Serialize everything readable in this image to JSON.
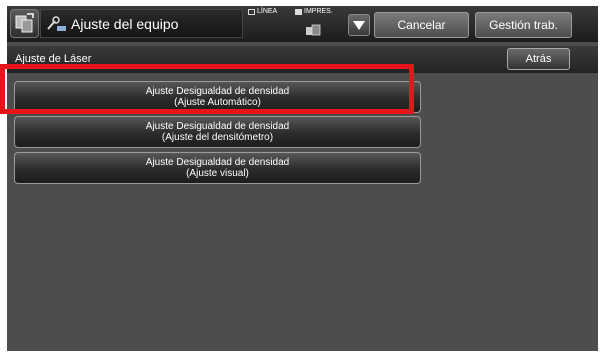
{
  "header": {
    "title": "Ajuste del equipo",
    "mode_line_label": "LÍNEA",
    "mode_impres_label": "IMPRES.",
    "cancel_label": "Cancelar",
    "gestion_label": "Gestión trab."
  },
  "subheader": {
    "title": "Ajuste de Láser",
    "back_label": "Atrás"
  },
  "options": [
    {
      "line1": "Ajuste Desigualdad de densidad",
      "line2": "(Ajuste Automático)"
    },
    {
      "line1": "Ajuste Desigualdad de densidad",
      "line2": "(Ajuste del densitómetro)"
    },
    {
      "line1": "Ajuste Desigualdad de densidad",
      "line2": "(Ajuste visual)"
    }
  ],
  "colors": {
    "highlight": "#e8141c",
    "background": "#4d4d4d"
  },
  "icons": {
    "home": "home-settings-icon",
    "title": "adjust-tools-icon",
    "printer": "printer-icon",
    "dropdown": "triangle-down-icon"
  }
}
